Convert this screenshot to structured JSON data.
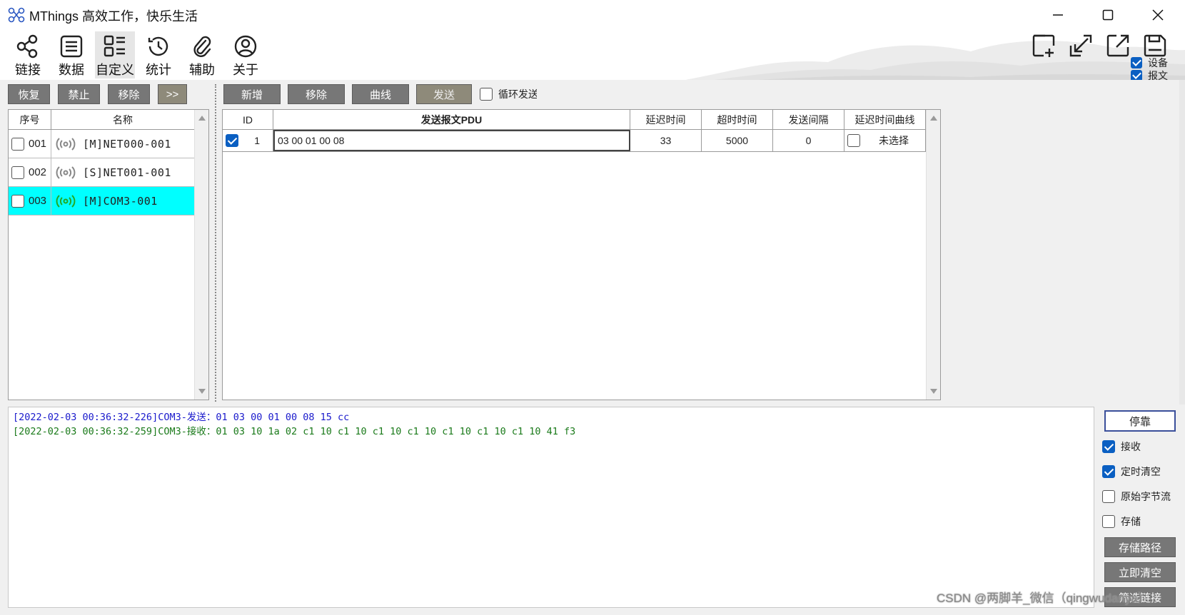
{
  "titlebar": {
    "app_name": "MThings",
    "slogan": "高效工作，快乐生活",
    "logo_icon": "molecule-icon",
    "minimize_icon": "minimize-icon",
    "maximize_icon": "maximize-icon",
    "close_icon": "close-icon"
  },
  "toolbar": {
    "items": [
      {
        "label": "链接",
        "icon": "share-icon"
      },
      {
        "label": "数据",
        "icon": "document-list-icon"
      },
      {
        "label": "自定义",
        "icon": "grid-list-icon",
        "active": true
      },
      {
        "label": "统计",
        "icon": "history-icon"
      },
      {
        "label": "辅助",
        "icon": "paperclip-icon"
      },
      {
        "label": "关于",
        "icon": "user-icon"
      }
    ],
    "right_icons": [
      "add-window-icon",
      "dock-in-icon",
      "pop-out-icon",
      "save-icon"
    ],
    "device_check_label": "设备",
    "device_checked": true,
    "message_check_label": "报文",
    "message_checked": true
  },
  "left_actions": {
    "restore": "恢复",
    "disable": "禁止",
    "remove": "移除",
    "expand": ">>"
  },
  "device_list": {
    "col_index": "序号",
    "col_name": "名称",
    "rows": [
      {
        "index": "001",
        "name": "[M]NET000-001",
        "checked": false,
        "selected": false,
        "signal_color": "#888888"
      },
      {
        "index": "002",
        "name": "[S]NET001-001",
        "checked": false,
        "selected": false,
        "signal_color": "#888888"
      },
      {
        "index": "003",
        "name": "[M]COM3-001",
        "checked": false,
        "selected": true,
        "signal_color": "#22aa22"
      }
    ]
  },
  "send_actions": {
    "add": "新增",
    "remove": "移除",
    "curve": "曲线",
    "send": "发送",
    "loop_label": "循环发送",
    "loop_checked": false
  },
  "send_table": {
    "headers": {
      "id": "ID",
      "pdu": "发送报文PDU",
      "delay": "延迟时间",
      "timeout": "超时时间",
      "interval": "发送间隔",
      "curve": "延迟时间曲线"
    },
    "rows": [
      {
        "checked": true,
        "id": "1",
        "pdu": "03 00 01 00 08",
        "delay": "33",
        "timeout": "5000",
        "interval": "0",
        "curve_checked": false,
        "curve": "未选择"
      }
    ]
  },
  "log": {
    "lines": [
      {
        "text": "[2022-02-03 00:36:32-226]COM3-发送：01 03 00 01 00 08 15 cc",
        "color": "#1a1acc"
      },
      {
        "text": "[2022-02-03 00:36:32-259]COM3-接收：01 03 10 1a 02 c1 10 c1 10 c1 10 c1 10 c1 10 c1 10 c1 10 41 f3",
        "color": "#1a7a1a"
      }
    ]
  },
  "side_panel": {
    "pause": "停靠",
    "receive_label": "接收",
    "receive_checked": true,
    "auto_clear_label": "定时清空",
    "auto_clear_checked": true,
    "raw_bytes_label": "原始字节流",
    "raw_bytes_checked": false,
    "store_label": "存储",
    "store_checked": false,
    "store_path": "存储路径",
    "clear_now": "立即清空",
    "filter_link": "筛选链接"
  },
  "watermark": "CSDN @两脚羊_微信（qingwudanya）"
}
